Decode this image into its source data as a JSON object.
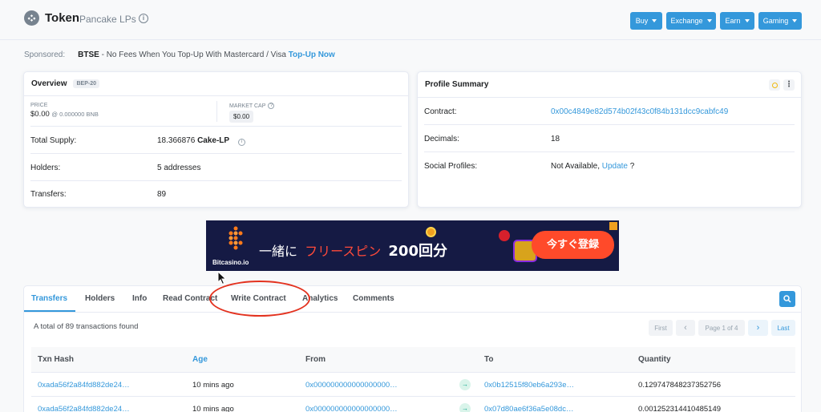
{
  "header": {
    "title": "Token",
    "subtitle": "Pancake LPs",
    "info_glyph": "i",
    "nav": [
      {
        "label": "Buy"
      },
      {
        "label": "Exchange"
      },
      {
        "label": "Earn"
      },
      {
        "label": "Gaming"
      }
    ]
  },
  "sponsored": {
    "label": "Sponsored:",
    "brand": "BTSE",
    "text": " - No Fees When You Top-Up With Mastercard / Visa ",
    "link": "Top-Up Now"
  },
  "overview": {
    "title": "Overview",
    "badge": "BEP-20",
    "price_label": "PRICE",
    "price_value": "$0.00",
    "price_sub": "@ 0.000000 BNB",
    "mcap_label": "MARKET CAP",
    "mcap_value": "$0.00",
    "total_supply_label": "Total Supply:",
    "total_supply_value": "18.366876",
    "total_supply_unit": "Cake-LP",
    "holders_label": "Holders:",
    "holders_value": "5 addresses",
    "transfers_label": "Transfers:",
    "transfers_value": "89"
  },
  "profile": {
    "title": "Profile Summary",
    "contract_label": "Contract:",
    "contract_value": "0x00c4849e82d574b02f43c0f84b131dcc9cabfc49",
    "decimals_label": "Decimals:",
    "decimals_value": "18",
    "social_label": "Social Profiles:",
    "social_value": "Not Available,",
    "social_link": "Update",
    "social_tail": "?"
  },
  "ad": {
    "brand": "Bitcasino.io",
    "text_jp": "一緒に",
    "text_red": "フリースピン",
    "text_num": "200回分",
    "cta": "今すぐ登録"
  },
  "tabs": [
    {
      "label": "Transfers"
    },
    {
      "label": "Holders"
    },
    {
      "label": "Info"
    },
    {
      "label": "Read Contract"
    },
    {
      "label": "Write Contract"
    },
    {
      "label": "Analytics"
    },
    {
      "label": "Comments"
    }
  ],
  "summary": "A total of 89 transactions found",
  "pagination": {
    "first": "First",
    "prev": "‹",
    "page": "Page 1 of 4",
    "next": "›",
    "last": "Last"
  },
  "table": {
    "headers": [
      "Txn Hash",
      "Age",
      "From",
      "To",
      "Quantity"
    ],
    "rows": [
      {
        "hash": "0xada56f2a84fd882de24…",
        "age": "10 mins ago",
        "from": "0x000000000000000000…",
        "to": "0x0b12515f80eb6a293e…",
        "qty": "0.129747848237352756"
      },
      {
        "hash": "0xada56f2a84fd882de24…",
        "age": "10 mins ago",
        "from": "0x000000000000000000…",
        "to": "0x07d80ae6f36a5e08dc…",
        "qty": "0.001252314410485149"
      }
    ]
  },
  "colors": {
    "accent": "#3498db",
    "callout": "#e3321f"
  }
}
